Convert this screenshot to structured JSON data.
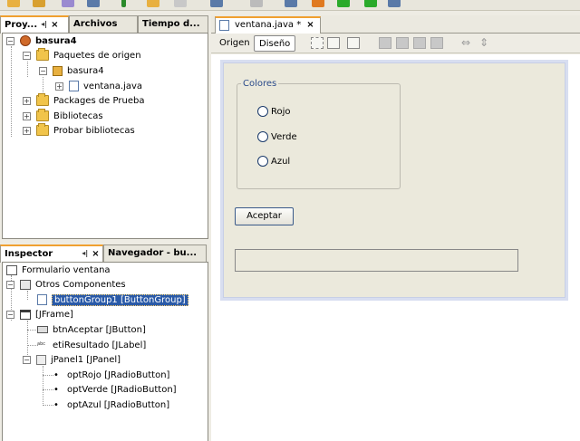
{
  "top_toolbar": {
    "icons": [
      "new-file-icon",
      "open-project-icon",
      "save-icon",
      "cut-icon",
      "run-icon",
      "debug-icon",
      "build-icon",
      "clean-build-icon",
      "run-main-icon",
      "step-icon",
      "continue-icon",
      "profile-icon"
    ]
  },
  "projects_panel": {
    "tabs": [
      {
        "label": "Proy...",
        "active": true
      },
      {
        "label": "Archivos",
        "active": false
      },
      {
        "label": "Tiempo d...",
        "active": false
      }
    ],
    "tree": [
      {
        "label": "basura4",
        "icon": "project-icon",
        "bold": true
      },
      {
        "label": "Paquetes de origen",
        "icon": "folder-icon"
      },
      {
        "label": "basura4",
        "icon": "package-icon"
      },
      {
        "label": "ventana.java",
        "icon": "java-file-icon"
      },
      {
        "label": "Packages de Prueba",
        "icon": "folder-icon"
      },
      {
        "label": "Bibliotecas",
        "icon": "folder-icon"
      },
      {
        "label": "Probar bibliotecas",
        "icon": "folder-icon"
      }
    ]
  },
  "inspector_panel": {
    "tabs": [
      {
        "label": "Inspector",
        "active": true
      },
      {
        "label": "Navegador - bu...",
        "active": false
      }
    ],
    "tree": [
      {
        "label": "Formulario ventana",
        "icon": "form-icon"
      },
      {
        "label": "Otros Componentes",
        "icon": "components-icon"
      },
      {
        "label": "buttonGroup1 [ButtonGroup]",
        "icon": "button-group-icon",
        "selected": true
      },
      {
        "label": "[JFrame]",
        "icon": "jframe-icon"
      },
      {
        "label": "btnAceptar [JButton]",
        "icon": "jbutton-icon"
      },
      {
        "label": "etiResultado [JLabel]",
        "icon": "jlabel-icon"
      },
      {
        "label": "jPanel1 [JPanel]",
        "icon": "jpanel-icon"
      },
      {
        "label": "optRojo [JRadioButton]",
        "icon": "jradiobutton-icon"
      },
      {
        "label": "optVerde [JRadioButton]",
        "icon": "jradiobutton-icon"
      },
      {
        "label": "optAzul [JRadioButton]",
        "icon": "jradiobutton-icon"
      }
    ]
  },
  "editor": {
    "tab_label": "ventana.java *",
    "mode_source": "Origen",
    "mode_design": "Diseño",
    "design_tools": [
      "selection-mode-icon",
      "connection-mode-icon",
      "preview-design-icon",
      "align-left-icon",
      "align-right-icon",
      "align-top-icon",
      "align-bottom-icon",
      "resize-horizontal-icon",
      "resize-vertical-icon"
    ]
  },
  "form": {
    "group_title": "Colores",
    "radios": [
      "Rojo",
      "Verde",
      "Azul"
    ],
    "accept_button": "Aceptar",
    "result_text": ""
  },
  "colors": {
    "selection": "#2a5aa8",
    "active_tab_accent": "#f0a030",
    "form_background": "#ebe9dc"
  }
}
